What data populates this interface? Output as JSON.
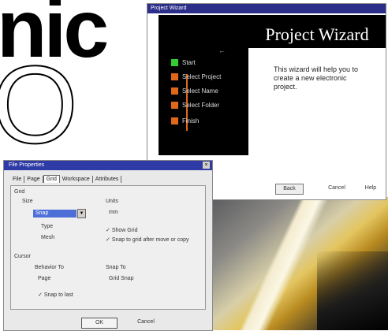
{
  "background": {
    "headline_fragment": "nic",
    "large_letter": "O"
  },
  "wizard": {
    "window_title": "Project Wizard",
    "banner_title": "Project Wizard",
    "description": "This wizard will help you to create a new electronic project.",
    "arrow": "←",
    "steps": [
      "Start",
      "Select Project",
      "Select Name",
      "Select Folder",
      "Finish"
    ],
    "buttons": {
      "back": "Back",
      "cancel": "Cancel",
      "help": "Help"
    }
  },
  "properties": {
    "window_title": "File Properties",
    "close_glyph": "×",
    "tabs": [
      "File",
      "Page",
      "Grid",
      "Workspace",
      "Attributes"
    ],
    "grid_section": "Grid",
    "size_label": "Size",
    "size_value": "Snap",
    "type_label": "Type",
    "type_value": "Mesh",
    "units_label": "Units",
    "units_value": "mm",
    "show_grid": "Show Grid",
    "snap_to_grid": "Snap to grid after move or copy",
    "cursor_section": "Cursor",
    "behavior_label": "Behavior To",
    "behavior_value": "Page",
    "snap_label": "Snap To",
    "snap_value": "Grid Snap",
    "snap_to_last": "Snap to last",
    "buttons": {
      "ok": "OK",
      "cancel": "Cancel"
    }
  },
  "colors": {
    "wizard_panel": "#000000",
    "step_marker": "#e0681a",
    "start_marker": "#33cc33",
    "titlebar": "#2e3aa6"
  }
}
